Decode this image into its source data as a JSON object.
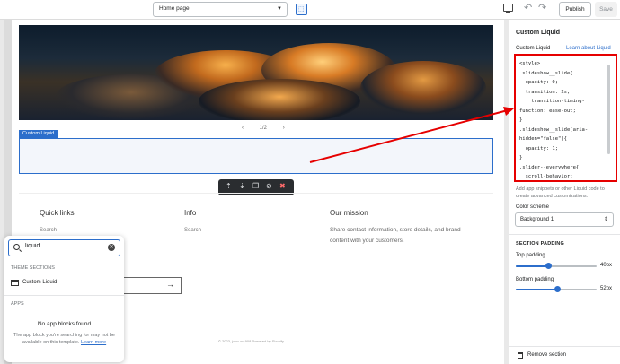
{
  "topbar": {
    "page_select": "Home page",
    "publish_label": "Publish",
    "save_label": "Save"
  },
  "preview": {
    "pager_text": "1/2",
    "custom_liquid_tag": "Custom Liquid",
    "footer": {
      "col1_heading": "Quick links",
      "col1_link": "Search",
      "col2_heading": "Info",
      "col2_link": "Search",
      "col3_heading": "Our mission",
      "col3_text": "Share contact information, store details, and brand content with your customers."
    },
    "copyright": "© 2023, john-xu-908 Powered by Shopify"
  },
  "search_popup": {
    "query": "liquid",
    "theme_sections_label": "THEME SECTIONS",
    "result_label": "Custom Liquid",
    "apps_label": "APPS",
    "no_blocks_title": "No app blocks found",
    "no_blocks_desc": "The app block you're searching for may not be available on this template.",
    "learn_more": "Learn more"
  },
  "panel": {
    "title": "Custom Liquid",
    "field_label": "Custom Liquid",
    "learn_link": "Learn about Liquid",
    "code_lines": [
      "<style>",
      ".slideshow__slide{",
      "  opacity: 0;",
      "  transition: 2s;",
      "    transition-timing-",
      "function: ease-out;",
      "}",
      ".slideshow__slide[aria-",
      "hidden=\"false\"]{",
      "  opacity: 1;",
      "}",
      ".slider--everywhere{",
      "  scroll-behavior:"
    ],
    "help_text": "Add app snippets or other Liquid code to create advanced customizations.",
    "color_scheme_label": "Color scheme",
    "color_scheme_value": "Background 1",
    "section_padding_label": "SECTION PADDING",
    "top_padding_label": "Top padding",
    "top_padding_value": "40px",
    "top_padding_fraction": 0.4,
    "bottom_padding_label": "Bottom padding",
    "bottom_padding_value": "52px",
    "bottom_padding_fraction": 0.52,
    "remove_label": "Remove section"
  },
  "colors": {
    "accent": "#2c6ecb",
    "annotation": "#e60000"
  }
}
